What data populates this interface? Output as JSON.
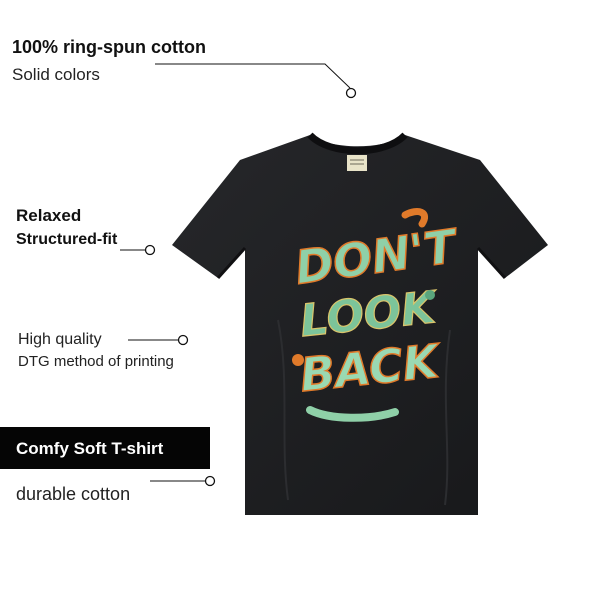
{
  "features": {
    "cotton": {
      "title": "100% ring-spun cotton",
      "subtitle": "Solid colors"
    },
    "fit": {
      "line1": "Relaxed",
      "line2": "Structured-fit"
    },
    "print": {
      "line1": "High quality",
      "line2": "DTG method of printing"
    },
    "soft": {
      "badge": "Comfy Soft T-shirt",
      "subtitle": "durable cotton"
    }
  },
  "product": {
    "graphic_text": "DON'T LOOK BACK",
    "shirt_color": "#1f2022",
    "graphic_colors": [
      "#8fd0a8",
      "#e07a2a",
      "#5aa57d",
      "#d9c46b"
    ]
  }
}
